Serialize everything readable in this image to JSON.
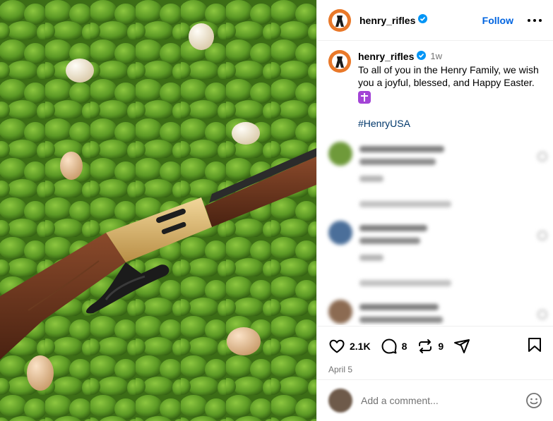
{
  "post": {
    "author": "henry_rifles",
    "follow_label": "Follow",
    "time": "1w",
    "caption": "To all of you in the Henry Family, we wish you a joyful, blessed, and Happy Easter.",
    "hashtag": "#HenryUSA",
    "date": "April 5"
  },
  "stats": {
    "likes": "2.1K",
    "comments": "8",
    "reposts": "9"
  },
  "composer": {
    "placeholder": "Add a comment..."
  },
  "icons": {
    "verified": "verified-badge-icon",
    "heart": "heart-icon",
    "comment": "comment-icon",
    "repost": "repost-icon",
    "share": "share-icon",
    "bookmark": "bookmark-icon",
    "emoji": "emoji-icon"
  },
  "colors": {
    "accent": "#0064e0",
    "verified": "#0095f6",
    "hashtag": "#00376b",
    "brand_orange": "#e9792a",
    "moss": "#4f8a1f",
    "muted": "#737373"
  }
}
